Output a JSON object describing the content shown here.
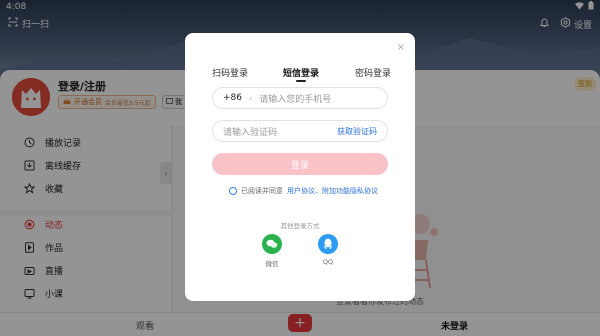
{
  "statusbar": {
    "time": "4:08"
  },
  "header": {
    "scan_label": "扫一扫",
    "settings_label": "设置"
  },
  "profile": {
    "title": "登录/注册",
    "vip_label": "开通会员",
    "vip_sub": "会员最低9.9元起",
    "badge2_label": "我",
    "signin_label": "签到"
  },
  "sidebar": {
    "items": [
      {
        "label": "播放记录",
        "icon": "history-icon"
      },
      {
        "label": "离线缓存",
        "icon": "download-icon"
      },
      {
        "label": "收藏",
        "icon": "star-icon"
      },
      {
        "label": "动态",
        "icon": "feed-icon",
        "active": true
      },
      {
        "label": "作品",
        "icon": "works-icon"
      },
      {
        "label": "直播",
        "icon": "live-icon"
      },
      {
        "label": "小课",
        "icon": "course-icon"
      }
    ]
  },
  "content": {
    "empty_text": "登录看看你发布过的动态"
  },
  "bottomnav": {
    "left_label": "观看",
    "plus_label": "+",
    "right_label": "未登录"
  },
  "modal": {
    "close": "×",
    "tabs": [
      "扫码登录",
      "短信登录",
      "密码登录"
    ],
    "active_tab": "短信登录",
    "country_code": "+86",
    "phone_placeholder": "请输入您的手机号",
    "code_placeholder": "请输入验证码",
    "get_code_label": "获取验证码",
    "login_label": "登录",
    "agree_text": "已阅读并同意",
    "agree_link": "用户协议、附加功能隐私协议",
    "other_methods_title": "其他登录方式",
    "wechat_label": "微信",
    "qq_label": "QQ"
  },
  "colors": {
    "accent": "#e4393c",
    "link": "#2a6fd6",
    "login_disabled": "#f9c2c6",
    "wechat": "#2bb24c",
    "qq": "#2b9cf2"
  }
}
